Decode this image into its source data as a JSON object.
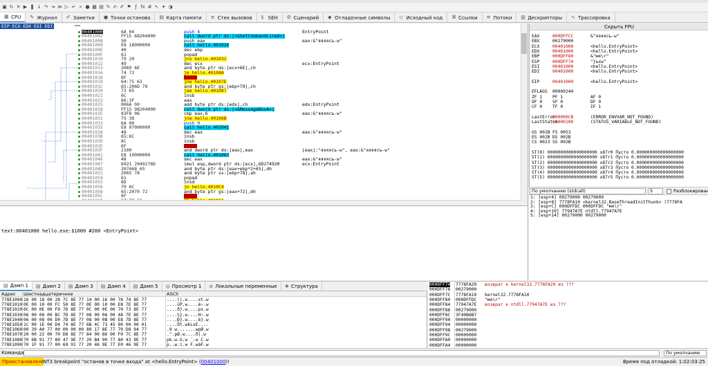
{
  "toolbar": {
    "icons": [
      "open-icon",
      "restart-icon",
      "close-icon",
      "run-icon",
      "pause-icon",
      "step-into-icon",
      "step-over-icon",
      "trace-icon",
      "animate-icon",
      "run-to-user-icon",
      "return-icon",
      "skip-icon",
      "breakpoint-icon",
      "memory-icon",
      "hardware-icon",
      "patch-icon",
      "comment-icon",
      "label-icon",
      "bookmark-icon",
      "function-icon",
      "fx-icon",
      "hash-icon",
      "cursor-icon",
      "highlight-icon",
      "theme-icon"
    ]
  },
  "tabs": [
    {
      "label": "CPU",
      "icon": "cpu-icon",
      "active": true
    },
    {
      "label": "Журнал",
      "icon": "log-icon"
    },
    {
      "label": "Заметки",
      "icon": "notes-icon"
    },
    {
      "label": "Точки останова",
      "icon": "breakpoint-dot-icon"
    },
    {
      "label": "Карта памяти",
      "icon": "memory-map-icon"
    },
    {
      "label": "Стек вызовов",
      "icon": "callstack-icon"
    },
    {
      "label": "SEH",
      "icon": "seh-icon"
    },
    {
      "label": "Сценарий",
      "icon": "script-icon"
    },
    {
      "label": "Отладочные символы",
      "icon": "symbols-icon"
    },
    {
      "label": "Исходный код",
      "icon": "source-icon"
    },
    {
      "label": "Ссылки",
      "icon": "references-icon"
    },
    {
      "label": "Потоки",
      "icon": "threads-icon"
    },
    {
      "label": "Дескрипторы",
      "icon": "handles-icon"
    },
    {
      "label": "Трассировка",
      "icon": "trace-tab-icon"
    }
  ],
  "disasm": {
    "regbar": "EIP ECX EDX ESI EDI",
    "rows": [
      {
        "addr": "00401000",
        "bytes": "6A 04",
        "ins": "push 4",
        "cmt": "EntryPoint",
        "cls": "push",
        "current": true
      },
      {
        "addr": "00401002",
        "bytes": "FF15 68204000",
        "ins": "call dword ptr ds:[<&GetCommandLineA>]",
        "cmt": "",
        "cls": "call"
      },
      {
        "addr": "00401008",
        "bytes": "50",
        "ins": "push eax",
        "cmt": "eax:&\"яяяясъ-w\"",
        "cls": ""
      },
      {
        "addr": "00401009",
        "bytes": "E8 18000000",
        "ins": "call hello.401026",
        "cmt": "",
        "cls": "call"
      },
      {
        "addr": "0040100E",
        "bytes": "40",
        "ins": "dec ebp",
        "cmt": "",
        "cls": ""
      },
      {
        "addr": "0040100F",
        "bytes": "61",
        "ins": "popad",
        "cmt": "",
        "cls": ""
      },
      {
        "addr": "00401010",
        "bytes": "79 20",
        "ins": "jns hello.401032",
        "cmt": "",
        "cls": "jmp"
      },
      {
        "addr": "00401012",
        "bytes": "49",
        "ins": "dec ecx",
        "cmt": "ecx:EntryPoint",
        "cls": ""
      },
      {
        "addr": "00401013",
        "bytes": "2069 6E",
        "ins": "and byte ptr ds:[ecx+6E],ch",
        "cmt": "",
        "cls": ""
      },
      {
        "addr": "00401016",
        "bytes": "74 72",
        "ins": "je hello.40108A",
        "cmt": "",
        "cls": "jmp"
      },
      {
        "addr": "00401018",
        "bytes": "6F",
        "ins": "outsd",
        "cmt": "",
        "cls": "red"
      },
      {
        "addr": "00401019",
        "bytes": "64:75 63",
        "ins": "jne hello.40107E",
        "cmt": "",
        "cls": "jmp"
      },
      {
        "addr": "0040101C",
        "bytes": "65:206D 79",
        "ins": "and byte ptr gs:[ebp+79],ch",
        "cmt": "",
        "cls": ""
      },
      {
        "addr": "00401020",
        "bytes": "73 65",
        "ins": "jae hello.401087",
        "cmt": "",
        "cls": "jmp"
      },
      {
        "addr": "00401022",
        "bytes": "6C",
        "ins": "insb",
        "cmt": "",
        "cls": ""
      },
      {
        "addr": "00401023",
        "bytes": "66:3F",
        "ins": "aas",
        "cmt": "",
        "cls": ""
      },
      {
        "addr": "00401025",
        "bytes": "006A 00",
        "ins": "add byte ptr ds:[edx],ch",
        "cmt": "edx:EntryPoint",
        "cls": ""
      },
      {
        "addr": "00401028",
        "bytes": "FF15 98204000",
        "ins": "call dword ptr ds:[<&MessageBoxA>]",
        "cmt": "",
        "cls": "call"
      },
      {
        "addr": "0040102E",
        "bytes": "83F8 06",
        "ins": "cmp eax,6",
        "cmt": "eax:&\"яяяясъ-w\"",
        "cls": ""
      },
      {
        "addr": "00401031",
        "bytes": "75 38",
        "ins": "jne hello.40106B",
        "cmt": "",
        "cls": "jmp"
      },
      {
        "addr": "00401033",
        "bytes": "6A 00",
        "ins": "push 0",
        "cmt": "",
        "cls": "push"
      },
      {
        "addr": "00401035",
        "bytes": "E8 07000000",
        "ins": "call hello.401041",
        "cmt": "",
        "cls": "call"
      },
      {
        "addr": "0040103A",
        "bytes": "48",
        "ins": "dec eax",
        "cmt": "eax:&\"яяяясъ-w\"",
        "cls": ""
      },
      {
        "addr": "0040103B",
        "bytes": "65:6C",
        "ins": "insb",
        "cmt": "",
        "cls": ""
      },
      {
        "addr": "0040103D",
        "bytes": "6C",
        "ins": "insb",
        "cmt": "",
        "cls": ""
      },
      {
        "addr": "0040103E",
        "bytes": "6F",
        "ins": "outsd",
        "cmt": "",
        "cls": "red"
      },
      {
        "addr": "0040103F",
        "bytes": "2100",
        "ins": "and dword ptr ds:[eax],eax",
        "cmt": "[eax]:\"яяяясъ-w\", eax:&\"яяяясъ-w\"",
        "cls": ""
      },
      {
        "addr": "00401041",
        "bytes": "E8 10000000",
        "ins": "call hello.401063",
        "cmt": "",
        "cls": "call"
      },
      {
        "addr": "00401046",
        "bytes": "48",
        "ins": "dec eax",
        "cmt": "eax:&\"яяяясъ-w\"",
        "cls": ""
      },
      {
        "addr": "00401047",
        "bytes": "6921 2049276D",
        "ins": "imul esp,dword ptr ds:[ecx],6D274920",
        "cmt": "ecx:EntryPoint",
        "cls": ""
      },
      {
        "addr": "0040104D",
        "bytes": "207468 65",
        "ins": "and byte ptr ds:[eax+ebp*2+65],dh",
        "cmt": "",
        "cls": ""
      },
      {
        "addr": "00401051",
        "bytes": "2065 78",
        "ins": "and byte ptr ss:[ebp+78],ah",
        "cmt": "",
        "cls": ""
      },
      {
        "addr": "00401054",
        "bytes": "61",
        "ins": "popad",
        "cmt": "",
        "cls": ""
      },
      {
        "addr": "00401055",
        "bytes": "6D",
        "ins": "insd",
        "cmt": "",
        "cls": ""
      },
      {
        "addr": "00401056",
        "bytes": "70 6C",
        "ins": "jo hello.4010C4",
        "cmt": "",
        "cls": "jmp"
      },
      {
        "addr": "00401058",
        "bytes": "65:2070 72",
        "ins": "and byte ptr gs:[eax+72],dh",
        "cmt": "",
        "cls": ""
      },
      {
        "addr": "0040105C",
        "bytes": "6F",
        "ins": "outsd",
        "cmt": "",
        "cls": "red"
      },
      {
        "addr": "0040105D",
        "bytes": "67:72 61",
        "ins": "jb hello.4010C1",
        "cmt": "",
        "cls": "jmp"
      }
    ]
  },
  "info": {
    "line": "text:00401000 hello.exe:$1000 #200 <EntryPoint>"
  },
  "registers": {
    "fpu_toggle": "Скрыть FPU",
    "rows": [
      {
        "name": "EAX",
        "val": "000DFFCC",
        "cmt": "&\"яяяясъ-w\"",
        "red": true
      },
      {
        "name": "EBX",
        "val": "00279000",
        "cmt": ""
      },
      {
        "name": "ECX",
        "val": "00401000",
        "cmt": "<hello.EntryPoint>",
        "red": true
      },
      {
        "name": "EDX",
        "val": "00401000",
        "cmt": "<hello.EntryPoint>",
        "red": true
      },
      {
        "name": "EBP",
        "val": "000DFF80",
        "cmt": "&\"мя\\r\"",
        "red": true
      },
      {
        "name": "ESP",
        "val": "000DFF74",
        "cmt": "\"}ъхw\"",
        "red": true
      },
      {
        "name": "ESI",
        "val": "00401000",
        "cmt": "<hello.EntryPoint>",
        "red": true
      },
      {
        "name": "EDI",
        "val": "00401000",
        "cmt": "<hello.EntryPoint>",
        "red": true
      },
      {
        "name": "",
        "val": "",
        "cmt": ""
      },
      {
        "name": "EIP",
        "val": "00401000",
        "cmt": "<hello.EntryPoint>",
        "red": true
      },
      {
        "name": "",
        "val": "",
        "cmt": ""
      },
      {
        "name": "EFLAGS",
        "val": "00000244",
        "cmt": ""
      },
      {
        "name": "ZF 1",
        "val": "PF 1",
        "cmt": "AF 0"
      },
      {
        "name": "OF 0",
        "val": "SF 0",
        "cmt": "DF 0"
      },
      {
        "name": "CF 0",
        "val": "TF 0",
        "cmt": "IF 1"
      },
      {
        "name": "",
        "val": "",
        "cmt": ""
      },
      {
        "name": "LastError",
        "val": "000000CB",
        "cmt": "(ERROR_ENVVAR_NOT_FOUND)",
        "red": true
      },
      {
        "name": "LastStatus",
        "val": "C0000100",
        "cmt": "(STATUS_VARIABLE_NOT_FOUND)",
        "red": true
      },
      {
        "name": "",
        "val": "",
        "cmt": ""
      },
      {
        "name": "GS 002B",
        "val": "FS 0053",
        "cmt": ""
      },
      {
        "name": "ES 002B",
        "val": "DS 002B",
        "cmt": ""
      },
      {
        "name": "CS 0023",
        "val": "SS 002B",
        "cmt": ""
      },
      {
        "name": "",
        "val": "",
        "cmt": ""
      },
      {
        "name": "ST(0) 0000000000000000000 x87r0 Пусто 0.000000000000000000",
        "val": "",
        "cmt": ""
      },
      {
        "name": "ST(1) 0000000000000000000 x87r1 Пусто 0.000000000000000000",
        "val": "",
        "cmt": ""
      },
      {
        "name": "ST(2) 0000000000000000000 x87r2 Пусто 0.000000000000000000",
        "val": "",
        "cmt": ""
      },
      {
        "name": "ST(3) 0000000000000000000 x87r3 Пусто 0.000000000000000000",
        "val": "",
        "cmt": ""
      },
      {
        "name": "ST(4) 0000000000000000000 x87r4 Пусто 0.000000000000000000",
        "val": "",
        "cmt": ""
      },
      {
        "name": "ST(5) 0000000000000000000 x87r5 Пусто 0.000000000000000000",
        "val": "",
        "cmt": ""
      }
    ]
  },
  "callconv": {
    "selected": "По умолчанию (stdcall)",
    "count": "5",
    "unlock_label": "Разблокировано"
  },
  "args": [
    "1: [esp+4] 00279000 00279000",
    "2: [esp+8] 7778FA10 <kernel32.BaseThreadInitThunk> (7778FA",
    "3: [esp+C] 000DFFDC 000DFFDC \"мя\\r\"",
    "4: [esp+10] 77947A7E ntdll.77947A7E",
    "5: [esp+14] 00279000 00279000"
  ],
  "dumptabs": [
    {
      "label": "Дамп 1",
      "icon": "dump-icon",
      "active": true
    },
    {
      "label": "Дамп 2",
      "icon": "dump-icon"
    },
    {
      "label": "Дамп 3",
      "icon": "dump-icon"
    },
    {
      "label": "Дамп 4",
      "icon": "dump-icon"
    },
    {
      "label": "Дамп 5",
      "icon": "dump-icon"
    },
    {
      "label": "Просмотр 1",
      "icon": "watch-icon"
    },
    {
      "label": "Локальные переменные",
      "icon": "locals-icon"
    },
    {
      "label": "Структура",
      "icon": "struct-icon"
    }
  ],
  "dump": {
    "headers": {
      "addr": "Адрес",
      "hex": "Шестнадцатеричное",
      "ascii": "ASCII"
    },
    "rows": [
      {
        "addr": "778E1000",
        "hex": "16 00 18 00 28 7C 8E 77 14 00 16 00 78 74 8E 77",
        "ascii": "....(|.w....xt.w"
      },
      {
        "addr": "778E1010",
        "hex": "0E 00 10 00 FC 50 8E 77 0E 00 10 00 E8 7E 8E 77",
        "ascii": "....üP.w....è~.w"
      },
      {
        "addr": "778E1020",
        "hex": "0C 00 0E 00 F0 7D 8E 77 0C 00 0E 00 70 73 8E 77",
        "ascii": "....ð}.w....ps.w"
      },
      {
        "addr": "778E1030",
        "hex": "06 00 08 00 BC 7D 8E 77 08 00 0A 00 48 7E 8E 77",
        "ascii": "....¼}.w....H~.w"
      },
      {
        "addr": "778E1040",
        "hex": "06 00 08 00 D0 7D 8E 77 08 00 0B 00 E8 7D 8E 77",
        "ascii": "....Ð}.w....è}.w"
      },
      {
        "addr": "778E1050",
        "hex": "1C 00 1E 00 D4 74 8E 77 6B 4C 73 45 00 00 00 01",
        "ascii": "....Ôt.wkLsE...."
      },
      {
        "addr": "778E1060",
        "hex": "00 39 A0 77 00 00 00 00 80 17 8E 77 70 D8 94 77",
        "ascii": ".9 w.......wpØ.w"
      },
      {
        "addr": "778E1070",
        "hex": "20 00 22 00 70 D8 8E 77 84 00 86 00 F0 7C 8E 77",
        "ascii": " .\".pØ.w....ð|.w"
      },
      {
        "addr": "778E1080",
        "hex": "70 6B 91 77 80 47 9E 77 20 B4 90 77 A0 43 9E 77",
        "ascii": "pk.w.G.w ´.w C.w"
      },
      {
        "addr": "778E1090",
        "hex": "70 1F 91 77 00 69 91 77 20 46 9E 77 E0 46 9E 77",
        "ascii": "p..w.i.w F.wàF.w"
      }
    ]
  },
  "stack": [
    {
      "addr": "000DFF74",
      "val": "7778FA29",
      "cmt": "возврат к kernel32.7778FA29 из ???",
      "current": true,
      "red": true
    },
    {
      "addr": "000DFF78",
      "val": "00279000",
      "cmt": ""
    },
    {
      "addr": "000DFF7C",
      "val": "7778FA10",
      "cmt": "kernel32.7778FA10"
    },
    {
      "addr": "000DFF80",
      "val": "000DFFDC",
      "cmt": "\"мя\\r\""
    },
    {
      "addr": "000DFF84",
      "val": "77947A7E",
      "cmt": "возврат к ntdll.77947A7E из ???",
      "red": true
    },
    {
      "addr": "000DFF88",
      "val": "00279000",
      "cmt": ""
    },
    {
      "addr": "000DFF8C",
      "val": "3F40B6B7",
      "cmt": ""
    },
    {
      "addr": "000DFF90",
      "val": "00000000",
      "cmt": ""
    },
    {
      "addr": "000DFF94",
      "val": "00000000",
      "cmt": ""
    },
    {
      "addr": "000DFF98",
      "val": "00279000",
      "cmt": ""
    },
    {
      "addr": "000DFF9C",
      "val": "00000000",
      "cmt": ""
    },
    {
      "addr": "000DFFA0",
      "val": "00000000",
      "cmt": ""
    },
    {
      "addr": "000DFFA4",
      "val": "00000000",
      "cmt": ""
    }
  ],
  "command": {
    "label": "Команда:",
    "mode": "По умолчанию"
  },
  "status": {
    "state": "Приостановлен",
    "message": "INT3 breakpoint \"останов в точке входа\" at <hello.EntryPoint> (",
    "link": "00401000",
    "suffix": ")!",
    "time": "Время под отладкой: 1:02:03:25"
  }
}
